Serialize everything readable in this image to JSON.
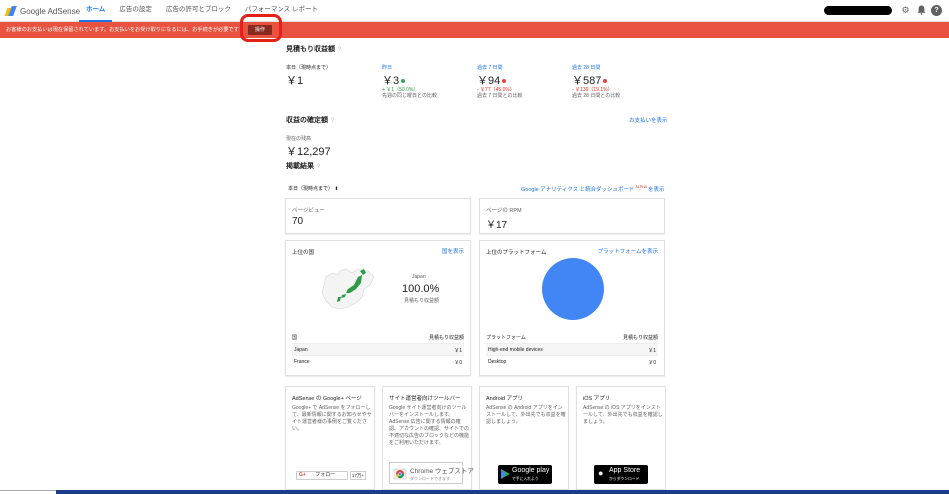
{
  "app": {
    "logo_text": "Google AdSense",
    "nav_tabs": [
      "ホーム",
      "広告の設定",
      "広告の許可とブロック",
      "パフォーマンス レポート"
    ],
    "icons": [
      "gear-icon",
      "bell-icon",
      "help-icon"
    ]
  },
  "alert": {
    "text": "お客様のお支払いは現在保留されています。お支払いをお受け取りになるには、お手続きが必要です",
    "button_label": "操作",
    "color": "#e8523f"
  },
  "estimated": {
    "title": "見積もり収益額",
    "today": {
      "label": "本日（現時点まで）",
      "value": "￥1"
    },
    "yesterday": {
      "label": "昨日",
      "value": "￥3",
      "change": "+ ￥1（50.0%）",
      "note": "先週の同じ曜日との比較"
    },
    "last7": {
      "label": "過去 7 日間",
      "value": "￥94",
      "change": "- ￥77（45.0%）",
      "note": "過去 7 日間との比較"
    },
    "last28": {
      "label": "過去 28 日間",
      "value": "￥587",
      "change": "- ￥139（19.1%）",
      "note": "過去 28 日間との比較"
    }
  },
  "confirmed": {
    "title": "収益の確定額",
    "link": "お支払いを表示",
    "balance_label": "現在の残高",
    "balance_value": "￥12,297"
  },
  "performance": {
    "title": "掲載結果",
    "range_select": "本日（現時点まで）",
    "analytics_link": "Google アナリティクス と統合",
    "dashboard_link": "ダッシュボード",
    "dashboard_badge": "ALPHA",
    "dashboard_suffix": "を表示",
    "pageviews": {
      "label": "ページビュー",
      "value": "70"
    },
    "rpm": {
      "label": "ページの RPM",
      "value": "￥17"
    }
  },
  "countries": {
    "title": "上位の国",
    "link": "国を表示",
    "highlight_name": "Japan",
    "highlight_pct": "100.0%",
    "highlight_caption": "見積もり収益額",
    "col_left": "国",
    "col_right": "見積もり収益額",
    "rows": [
      {
        "name": "Japan",
        "value": "￥1"
      },
      {
        "name": "France",
        "value": "￥0"
      }
    ]
  },
  "platforms": {
    "title": "上位のプラットフォーム",
    "link": "プラットフォームを表示",
    "col_left": "プラットフォーム",
    "col_right": "見積もり収益額",
    "rows": [
      {
        "name": "High-end mobile devices",
        "value": "￥1"
      },
      {
        "name": "Desktop",
        "value": "￥0"
      }
    ],
    "pie_share": 1.0,
    "pie_color": "#4285f4"
  },
  "promos": [
    {
      "title": "AdSense の Google+ ページ",
      "desc": "Google+ で AdSense をフォローして、最新情報に関するお知らせやサイト運営者様の事例をご覧ください。",
      "btn": "フォロー",
      "count": "17万+"
    },
    {
      "title": "サイト運営者向けツールバー",
      "desc": "Google サイト運営者向けのツールバーをインストールします。AdSense 広告に関する情報の確認、アカウントの確認、サイトでの不適切な広告のブロックなどの機能をご利用いただけます。",
      "btn": "Chrome ウェブストア",
      "btn_sub": "ダウンロードできます"
    },
    {
      "title": "Android アプリ",
      "desc": "AdSense の Android アプリをインストールして、外出先でも収益を確認しましょう。",
      "btn": "Google play",
      "btn_sub": "で手に入れよう"
    },
    {
      "title": "iOS アプリ",
      "desc": "AdSense の iOS アプリをインストールして、外出先でも収益を確認しましょう。",
      "btn": "App Store",
      "btn_sub": "からダウンロード"
    }
  ]
}
